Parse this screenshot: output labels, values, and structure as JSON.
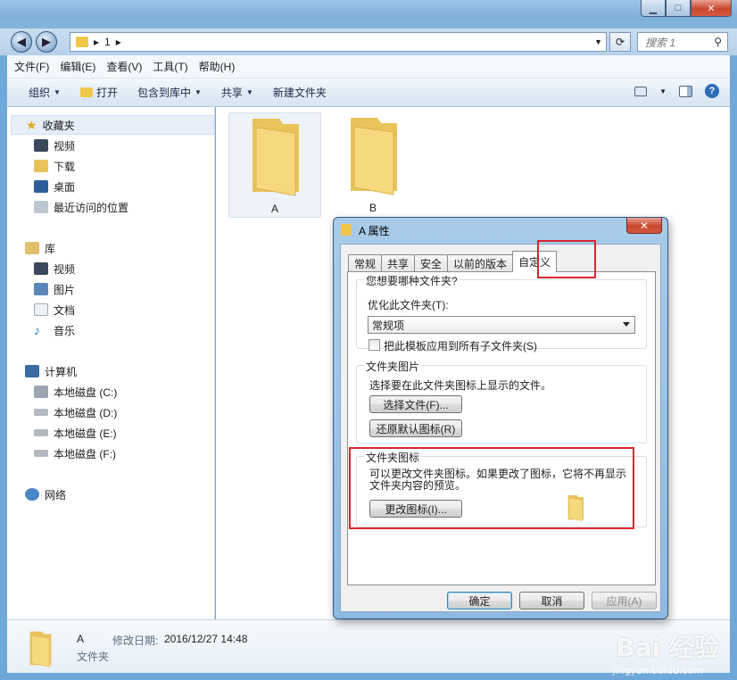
{
  "address": {
    "path_segments": [
      "1"
    ]
  },
  "search": {
    "placeholder": "搜索 1"
  },
  "menu": {
    "items": [
      "文件(F)",
      "编辑(E)",
      "查看(V)",
      "工具(T)",
      "帮助(H)"
    ]
  },
  "commands": {
    "organize": "组织",
    "open": "打开",
    "include": "包含到库中",
    "share": "共享",
    "new_folder": "新建文件夹"
  },
  "nav": {
    "favorites": "收藏夹",
    "videos": "视频",
    "downloads": "下载",
    "desktop": "桌面",
    "recent": "最近访问的位置",
    "libraries": "库",
    "lib_videos": "视频",
    "lib_pictures": "图片",
    "lib_docs": "文档",
    "lib_music": "音乐",
    "computer": "计算机",
    "drive_c": "本地磁盘 (C:)",
    "drive_d": "本地磁盘 (D:)",
    "drive_e": "本地磁盘 (E:)",
    "drive_f": "本地磁盘 (F:)",
    "network": "网络"
  },
  "files": [
    {
      "name": "A"
    },
    {
      "name": "B"
    }
  ],
  "details": {
    "name": "A",
    "type": "文件夹",
    "modified_label": "修改日期:",
    "modified_value": "2016/12/27 14:48"
  },
  "dialog": {
    "title": "A 属性",
    "tabs": [
      "常规",
      "共享",
      "安全",
      "以前的版本",
      "自定义"
    ],
    "active_tab": "自定义",
    "q_type": "您想要哪种文件夹?",
    "optimize_label": "优化此文件夹(T):",
    "optimize_value": "常规项",
    "apply_template": "把此模板应用到所有子文件夹(S)",
    "pictures_group": "文件夹图片",
    "pictures_desc": "选择要在此文件夹图标上显示的文件。",
    "choose_file": "选择文件(F)...",
    "restore_default": "还原默认图标(R)",
    "icons_group": "文件夹图标",
    "icons_desc_1": "可以更改文件夹图标。如果更改了图标，它将不再显示",
    "icons_desc_2": "文件夹内容的预览。",
    "change_icon": "更改图标(I)...",
    "ok": "确定",
    "cancel": "取消",
    "apply": "应用(A)"
  },
  "watermark": {
    "logo": "Bai 经验",
    "url": "jingyan.baidu.com"
  }
}
